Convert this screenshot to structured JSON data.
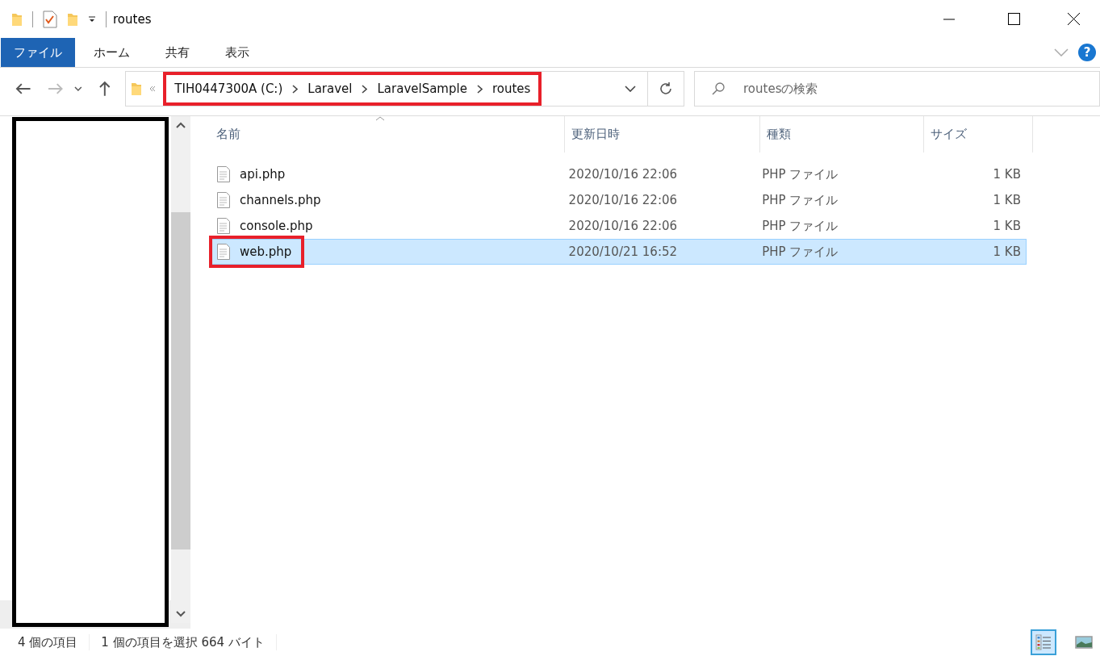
{
  "window": {
    "title": "routes"
  },
  "ribbon": {
    "tabs": [
      {
        "label": "ファイル",
        "selected": true
      },
      {
        "label": "ホーム",
        "selected": false
      },
      {
        "label": "共有",
        "selected": false
      },
      {
        "label": "表示",
        "selected": false
      }
    ],
    "help": "?"
  },
  "address": {
    "highlighted": true,
    "path": [
      "TIH0447300A (C:)",
      "Laravel",
      "LaravelSample",
      "routes"
    ]
  },
  "search": {
    "placeholder": "routesの検索"
  },
  "table": {
    "columns": [
      "名前",
      "更新日時",
      "種類",
      "サイズ"
    ],
    "rows": [
      {
        "name": "api.php",
        "modified": "2020/10/16 22:06",
        "type": "PHP ファイル",
        "size": "1 KB",
        "selected": false,
        "highlighted": false
      },
      {
        "name": "channels.php",
        "modified": "2020/10/16 22:06",
        "type": "PHP ファイル",
        "size": "1 KB",
        "selected": false,
        "highlighted": false
      },
      {
        "name": "console.php",
        "modified": "2020/10/16 22:06",
        "type": "PHP ファイル",
        "size": "1 KB",
        "selected": false,
        "highlighted": false
      },
      {
        "name": "web.php",
        "modified": "2020/10/21 16:52",
        "type": "PHP ファイル",
        "size": "1 KB",
        "selected": true,
        "highlighted": true
      }
    ]
  },
  "status_bar": {
    "count": "4 個の項目",
    "selection": "1 個の項目を選択  664 バイト"
  }
}
